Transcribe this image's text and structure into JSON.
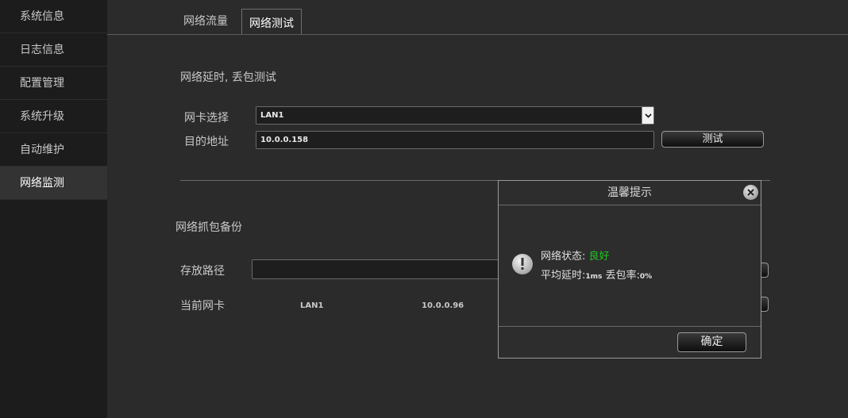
{
  "sidebar": {
    "items": [
      {
        "label": "系统信息"
      },
      {
        "label": "日志信息"
      },
      {
        "label": "配置管理"
      },
      {
        "label": "系统升级"
      },
      {
        "label": "自动维护"
      },
      {
        "label": "网络监测",
        "active": true
      }
    ]
  },
  "tabs": [
    {
      "label": "网络流量"
    },
    {
      "label": "网络测试",
      "active": true
    }
  ],
  "test_section": {
    "title": "网络延时, 丢包测试",
    "nic_label": "网卡选择",
    "nic_value": "LAN1",
    "dest_label": "目的地址",
    "dest_value": "10.0.0.158",
    "test_button": "测试"
  },
  "capture_section": {
    "title": "网络抓包备份",
    "path_label": "存放路径",
    "path_value": "",
    "current_nic_label": "当前网卡",
    "current_nic_name": "LAN1",
    "current_nic_ip": "10.0.0.96"
  },
  "dialog": {
    "title": "温馨提示",
    "status_label": "网络状态: ",
    "status_value": "良好",
    "status_color": "#21c721",
    "latency_label": "平均延时:",
    "latency_value": "1ms",
    "loss_label": " 丢包率:",
    "loss_value": "0%",
    "ok_button": "确定"
  },
  "icons": {
    "close": "close-icon",
    "warning": "exclamation-icon",
    "dropdown": "chevron-down-icon"
  }
}
